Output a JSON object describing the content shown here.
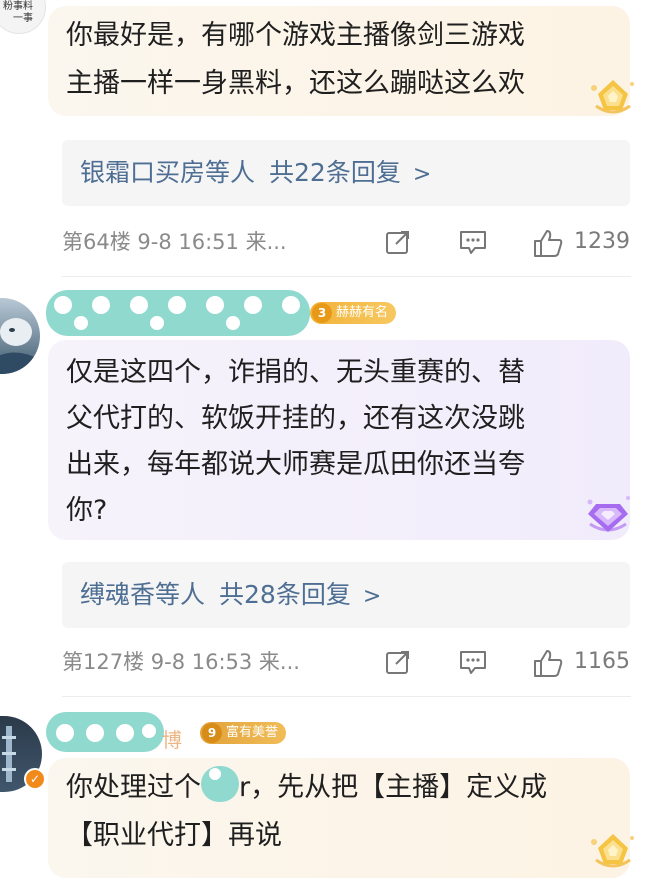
{
  "comments": [
    {
      "lines": [
        "你最好是，有哪个游戏主播像剑三游戏",
        "主播一样一身黑料，还这么蹦哒这么欢"
      ],
      "reply_names": "银霜口买房等人",
      "reply_count": "共22条回复",
      "floor_meta": "第64楼  9-8 16:51 来...",
      "likes": "1239",
      "avatar_text": [
        "粉事料",
        "一事"
      ]
    },
    {
      "badge_level": "3",
      "badge_text": "赫赫有名",
      "lines": [
        "仅是这四个，诈捐的、无头重赛的、替",
        "父代打的、软饭开挂的，还有这次没跳",
        "出来，每年都说大师赛是瓜田你还当夸",
        "你?"
      ],
      "reply_names": "缚魂香等人",
      "reply_count": "共28条回复",
      "floor_meta": "第127楼  9-8 16:53 来...",
      "likes": "1165"
    },
    {
      "name_partial": "博",
      "badge_level": "9",
      "badge_text": "富有美誉",
      "line1_before": "你处理过个",
      "line1_after": "r，先从把【主播】定义成",
      "line2": "【职业代打】再说"
    }
  ],
  "reply_chevron": ">",
  "colors": {
    "link": "#4e6f93",
    "meta": "#8a8a8a",
    "teal_blur": "#8fd9cf",
    "badge_gold": "#f2b63a",
    "badge_purple": "#b27df2"
  }
}
